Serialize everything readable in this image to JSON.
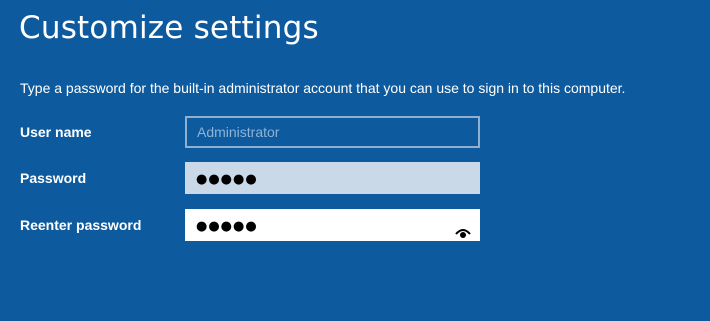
{
  "page": {
    "title": "Customize settings",
    "instruction": "Type a password for the built-in administrator account that you can use to sign in to this computer."
  },
  "form": {
    "username": {
      "label": "User name",
      "placeholder": "Administrator",
      "value": "",
      "disabled": true
    },
    "password": {
      "label": "Password",
      "masked_value": "●●●●●"
    },
    "reenter_password": {
      "label": "Reenter password",
      "masked_value": "●●●●●",
      "reveal_icon": "eye-icon"
    }
  },
  "colors": {
    "background": "#0d5a9e",
    "text": "#ffffff",
    "disabled_border": "#8fb0d0",
    "filled_field": "#c9d9e8",
    "active_field": "#ffffff"
  }
}
